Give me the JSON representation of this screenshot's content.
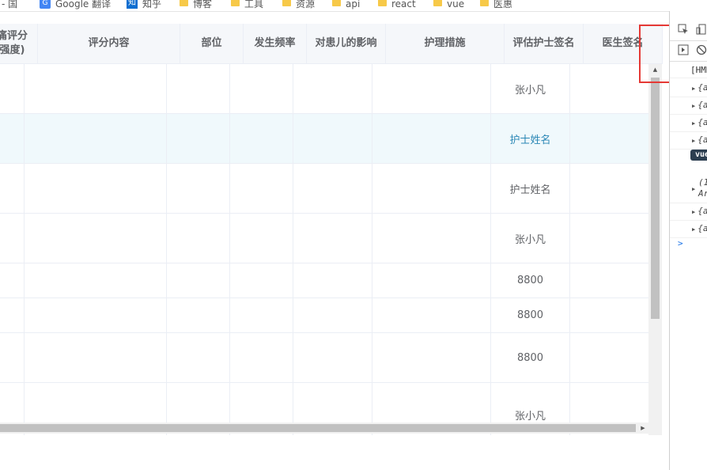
{
  "bookmarks": [
    {
      "label": "- 国",
      "icon": "none"
    },
    {
      "label": "Google 翻译",
      "icon": "google-translate-icon"
    },
    {
      "label": "知乎",
      "icon": "zhihu-icon"
    },
    {
      "label": "博客",
      "icon": "folder-icon"
    },
    {
      "label": "工具",
      "icon": "folder-icon"
    },
    {
      "label": "资源",
      "icon": "folder-icon"
    },
    {
      "label": "api",
      "icon": "folder-icon"
    },
    {
      "label": "react",
      "icon": "folder-icon"
    },
    {
      "label": "vue",
      "icon": "folder-icon"
    },
    {
      "label": "医惠",
      "icon": "folder-icon"
    }
  ],
  "table": {
    "headers": [
      {
        "label": "痛评分\n强度)"
      },
      {
        "label": "评分内容"
      },
      {
        "label": "部位"
      },
      {
        "label": "发生频率"
      },
      {
        "label": "对患儿的影响"
      },
      {
        "label": "护理措施"
      },
      {
        "label": "评估护士签名"
      },
      {
        "label": "医生签名"
      }
    ],
    "rows": [
      {
        "nurse": "张小凡",
        "highlighted": false
      },
      {
        "nurse": "护士姓名",
        "highlighted": true
      },
      {
        "nurse": "护士姓名",
        "highlighted": false
      },
      {
        "nurse": "张小凡",
        "highlighted": false
      },
      {
        "nurse": "8800",
        "highlighted": false
      },
      {
        "nurse": "8800",
        "highlighted": false
      },
      {
        "nurse": "8800",
        "highlighted": false
      },
      {
        "nurse": "张小凡",
        "highlighted": false
      }
    ]
  },
  "devtools": {
    "header_text": "[HMR",
    "entries": [
      "{a",
      "{a",
      "{a",
      "{a"
    ],
    "vue_badge": "vue",
    "array_entry_1": "(1",
    "array_entry_2": "Ar",
    "entries_after": [
      "{a",
      "{a"
    ],
    "prompt": ">"
  },
  "colors": {
    "header_bg": "#f5f7fa",
    "highlight_row": "#f0f9fc",
    "link_text": "#2a87b5",
    "annotation_box": "#e53935"
  }
}
